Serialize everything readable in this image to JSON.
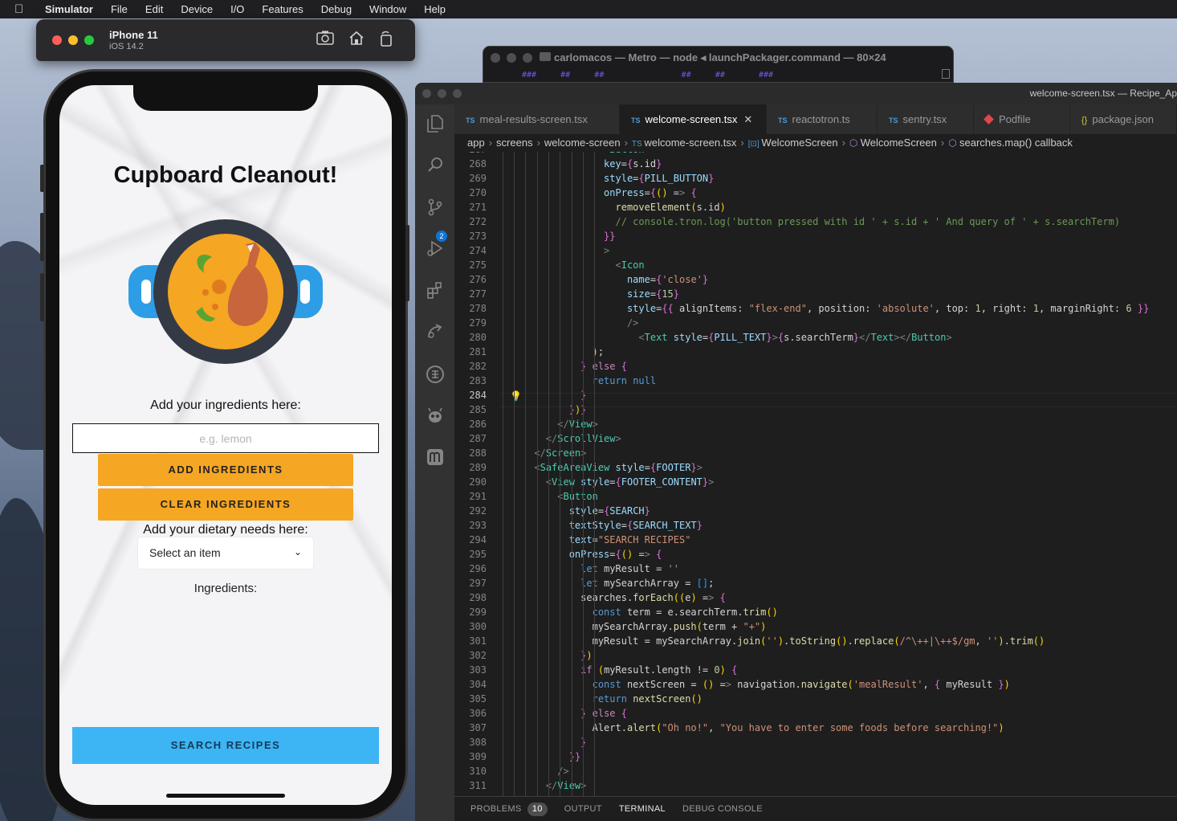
{
  "menubar": {
    "app": "Simulator",
    "items": [
      "File",
      "Edit",
      "Device",
      "I/O",
      "Features",
      "Debug",
      "Window",
      "Help"
    ]
  },
  "simulator": {
    "device_name": "iPhone 11",
    "os": "iOS 14.2"
  },
  "app": {
    "title": "Cupboard Cleanout!",
    "ingredients_label": "Add your ingredients here:",
    "ingredients_placeholder": "e.g. lemon",
    "add_button": "ADD INGREDIENTS",
    "clear_button": "CLEAR INGREDIENTS",
    "dietary_label": "Add your dietary needs here:",
    "dietary_select": "Select an item",
    "list_label": "Ingredients:",
    "search_button": "SEARCH RECIPES"
  },
  "terminal": {
    "title": "carlomacos — Metro — node ◂ launchPackager.command — 80×24",
    "output": "###     ##     ##                ##     ##       ###"
  },
  "vscode": {
    "window_title": "welcome-screen.tsx — Recipe_Ap",
    "tabs": [
      {
        "icon": "TS",
        "label": "meal-results-screen.tsx",
        "active": false
      },
      {
        "icon": "TS",
        "label": "welcome-screen.tsx",
        "active": true
      },
      {
        "icon": "TS",
        "label": "reactotron.ts",
        "active": false
      },
      {
        "icon": "TS",
        "label": "sentry.tsx",
        "active": false
      },
      {
        "icon": "ruby",
        "label": "Podfile",
        "active": false
      },
      {
        "icon": "{}",
        "label": "package.json",
        "active": false
      }
    ],
    "breadcrumb": [
      "app",
      "screens",
      "welcome-screen",
      "welcome-screen.tsx",
      "WelcomeScreen",
      "WelcomeScreen",
      "searches.map() callback"
    ],
    "source_control_badge": "2",
    "current_line": 284,
    "panel": {
      "tabs": [
        "PROBLEMS",
        "OUTPUT",
        "TERMINAL",
        "DEBUG CONSOLE"
      ],
      "problems_count": "10",
      "active": "TERMINAL"
    },
    "code_lines": [
      {
        "n": "267",
        "t": "                  <Button"
      },
      {
        "n": "268",
        "t": "                  key={s.id}"
      },
      {
        "n": "269",
        "t": "                  style={PILL_BUTTON}"
      },
      {
        "n": "270",
        "t": "                  onPress={() => {"
      },
      {
        "n": "271",
        "t": "                    removeElement(s.id)"
      },
      {
        "n": "272",
        "t": "                    // console.tron.log('button pressed with id ' + s.id + ' And query of ' + s.searchTerm)"
      },
      {
        "n": "273",
        "t": "                  }}"
      },
      {
        "n": "274",
        "t": "                  >"
      },
      {
        "n": "275",
        "t": "                    <Icon"
      },
      {
        "n": "276",
        "t": "                      name={'close'}"
      },
      {
        "n": "277",
        "t": "                      size={15}"
      },
      {
        "n": "278",
        "t": "                      style={{ alignItems: \"flex-end\", position: 'absolute', top: 1, right: 1, marginRight: 6 }}"
      },
      {
        "n": "279",
        "t": "                      />"
      },
      {
        "n": "280",
        "t": "                        <Text style={PILL_TEXT}>{s.searchTerm}</Text></Button>"
      },
      {
        "n": "281",
        "t": "                );"
      },
      {
        "n": "282",
        "t": "              } else {"
      },
      {
        "n": "283",
        "t": "                return null"
      },
      {
        "n": "284",
        "t": "              }"
      },
      {
        "n": "285",
        "t": "            })}"
      },
      {
        "n": "286",
        "t": "          </View>"
      },
      {
        "n": "287",
        "t": "        </ScrollView>"
      },
      {
        "n": "288",
        "t": "      </Screen>"
      },
      {
        "n": "289",
        "t": "      <SafeAreaView style={FOOTER}>"
      },
      {
        "n": "290",
        "t": "        <View style={FOOTER_CONTENT}>"
      },
      {
        "n": "291",
        "t": "          <Button"
      },
      {
        "n": "292",
        "t": "            style={SEARCH}"
      },
      {
        "n": "293",
        "t": "            textStyle={SEARCH_TEXT}"
      },
      {
        "n": "294",
        "t": "            text=\"SEARCH RECIPES\""
      },
      {
        "n": "295",
        "t": "            onPress={() => {"
      },
      {
        "n": "296",
        "t": "              let myResult = ''"
      },
      {
        "n": "297",
        "t": "              let mySearchArray = [];"
      },
      {
        "n": "298",
        "t": "              searches.forEach((e) => {"
      },
      {
        "n": "299",
        "t": "                const term = e.searchTerm.trim()"
      },
      {
        "n": "300",
        "t": "                mySearchArray.push(term + \"+\")"
      },
      {
        "n": "301",
        "t": "                myResult = mySearchArray.join('').toString().replace(/^\\++|\\++$/gm, '').trim()"
      },
      {
        "n": "302",
        "t": "              })"
      },
      {
        "n": "303",
        "t": "              if (myResult.length != 0) {"
      },
      {
        "n": "304",
        "t": "                const nextScreen = () => navigation.navigate('mealResult', { myResult })"
      },
      {
        "n": "305",
        "t": "                return nextScreen()"
      },
      {
        "n": "306",
        "t": "              } else {"
      },
      {
        "n": "307",
        "t": "                Alert.alert(\"Oh no!\", \"You have to enter some foods before searching!\")"
      },
      {
        "n": "308",
        "t": "              }"
      },
      {
        "n": "309",
        "t": "            }}"
      },
      {
        "n": "310",
        "t": "          />"
      },
      {
        "n": "311",
        "t": "        </View>"
      }
    ]
  },
  "colors": {
    "pill": "#f5a623",
    "search": "#3db5f5",
    "editor_bg": "#1e1e1e"
  }
}
